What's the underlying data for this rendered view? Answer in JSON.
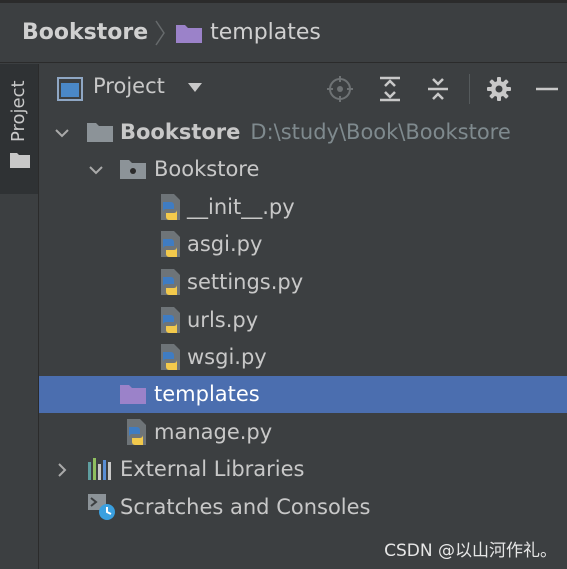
{
  "breadcrumb": {
    "root": "Bookstore",
    "leaf": "templates"
  },
  "tool_strip": {
    "tab_label": "Project"
  },
  "project_panel": {
    "title": "Project",
    "actions": [
      "locate-icon",
      "expand-all-icon",
      "collapse-all-icon",
      "gear-icon",
      "minimize-icon"
    ]
  },
  "tree": {
    "root": {
      "label": "Bookstore",
      "path": "D:\\study\\Book\\Bookstore"
    },
    "package": {
      "label": "Bookstore"
    },
    "files": [
      {
        "label": "__init__.py"
      },
      {
        "label": "asgi.py"
      },
      {
        "label": "settings.py"
      },
      {
        "label": "urls.py"
      },
      {
        "label": "wsgi.py"
      }
    ],
    "templates": {
      "label": "templates"
    },
    "manage": {
      "label": "manage.py"
    },
    "external_libraries": {
      "label": "External Libraries"
    },
    "scratches": {
      "label": "Scratches and Consoles"
    }
  },
  "watermark": "CSDN @以山河作礼。",
  "colors": {
    "background": "#3c3f41",
    "selection": "#4b6eaf",
    "folder_purple": "#9b82c9",
    "folder_gray": "#8c9398",
    "python_blue": "#3f7cc2",
    "python_yellow": "#f2c94c"
  }
}
